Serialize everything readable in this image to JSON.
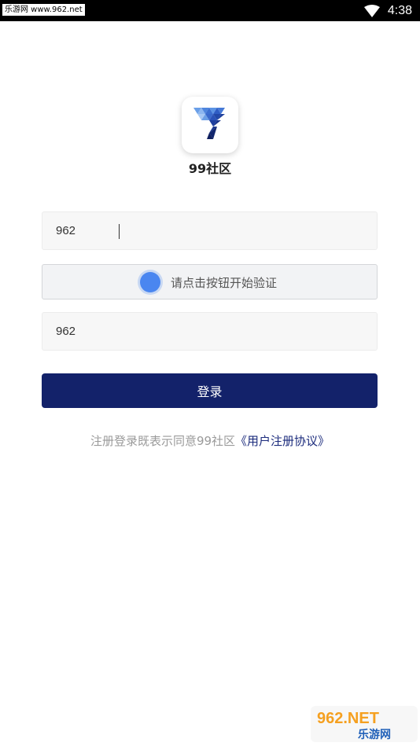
{
  "statusbar": {
    "site_label": "乐游网 www.962.net",
    "time": "4:38",
    "wifi_icon": "wifi-icon"
  },
  "app": {
    "name": "99社区",
    "logo_icon": "gem-triangle-logo-icon",
    "brand_color": "#13226a"
  },
  "form": {
    "account_value": "962",
    "verify_text": "请点击按钮开始验证",
    "password_value": "962",
    "login_label": "登录"
  },
  "agreement": {
    "prefix": "注册登录既表示同意99社区",
    "link": "《用户注册协议》"
  },
  "watermark": {
    "line1": "962.NET",
    "line2": "乐游网"
  }
}
